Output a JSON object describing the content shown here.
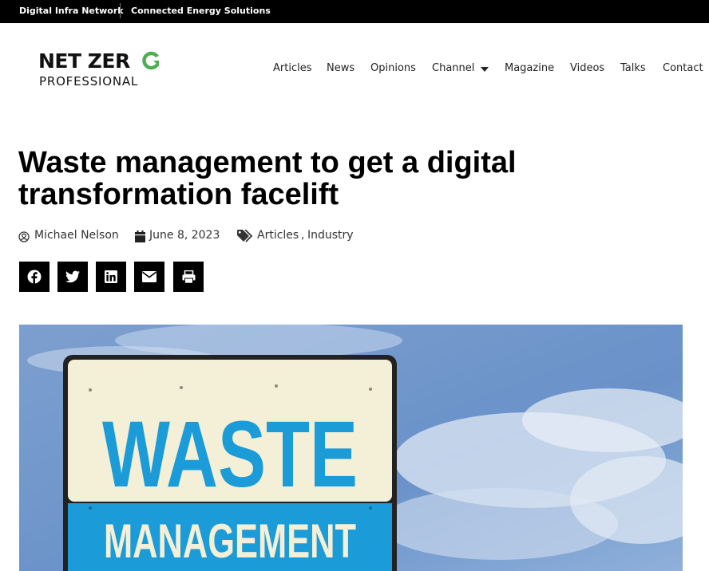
{
  "topbar": {
    "links": [
      {
        "label": "Digital Infra Network"
      },
      {
        "label": "Connected Energy Solutions"
      }
    ]
  },
  "logo": {
    "line1": "NET ZER",
    "line2": "PROFESSIONAL",
    "accent": "#4caf50"
  },
  "nav": {
    "items": [
      {
        "label": "Articles"
      },
      {
        "label": "News"
      },
      {
        "label": "Opinions"
      },
      {
        "label": "Channel"
      },
      {
        "label": "Magazine"
      },
      {
        "label": "Videos"
      },
      {
        "label": "Talks"
      },
      {
        "label": "Contact"
      }
    ]
  },
  "article": {
    "title": "Waste management to get a digital transformation facelift",
    "author": "Michael Nelson",
    "date": "June 8, 2023",
    "categories": [
      {
        "label": "Articles"
      },
      {
        "label": "Industry"
      }
    ],
    "category_separator": ","
  },
  "share": {
    "buttons": [
      {
        "icon": "facebook-icon"
      },
      {
        "icon": "twitter-icon"
      },
      {
        "icon": "linkedin-icon"
      },
      {
        "icon": "email-icon"
      },
      {
        "icon": "print-icon"
      }
    ]
  },
  "hero": {
    "sign_line1": "WASTE",
    "sign_line2": "MANAGEMENT",
    "sky_color": "#6f95c8",
    "sign_blue": "#1b9bd7",
    "sign_cream": "#f4f0d8"
  }
}
